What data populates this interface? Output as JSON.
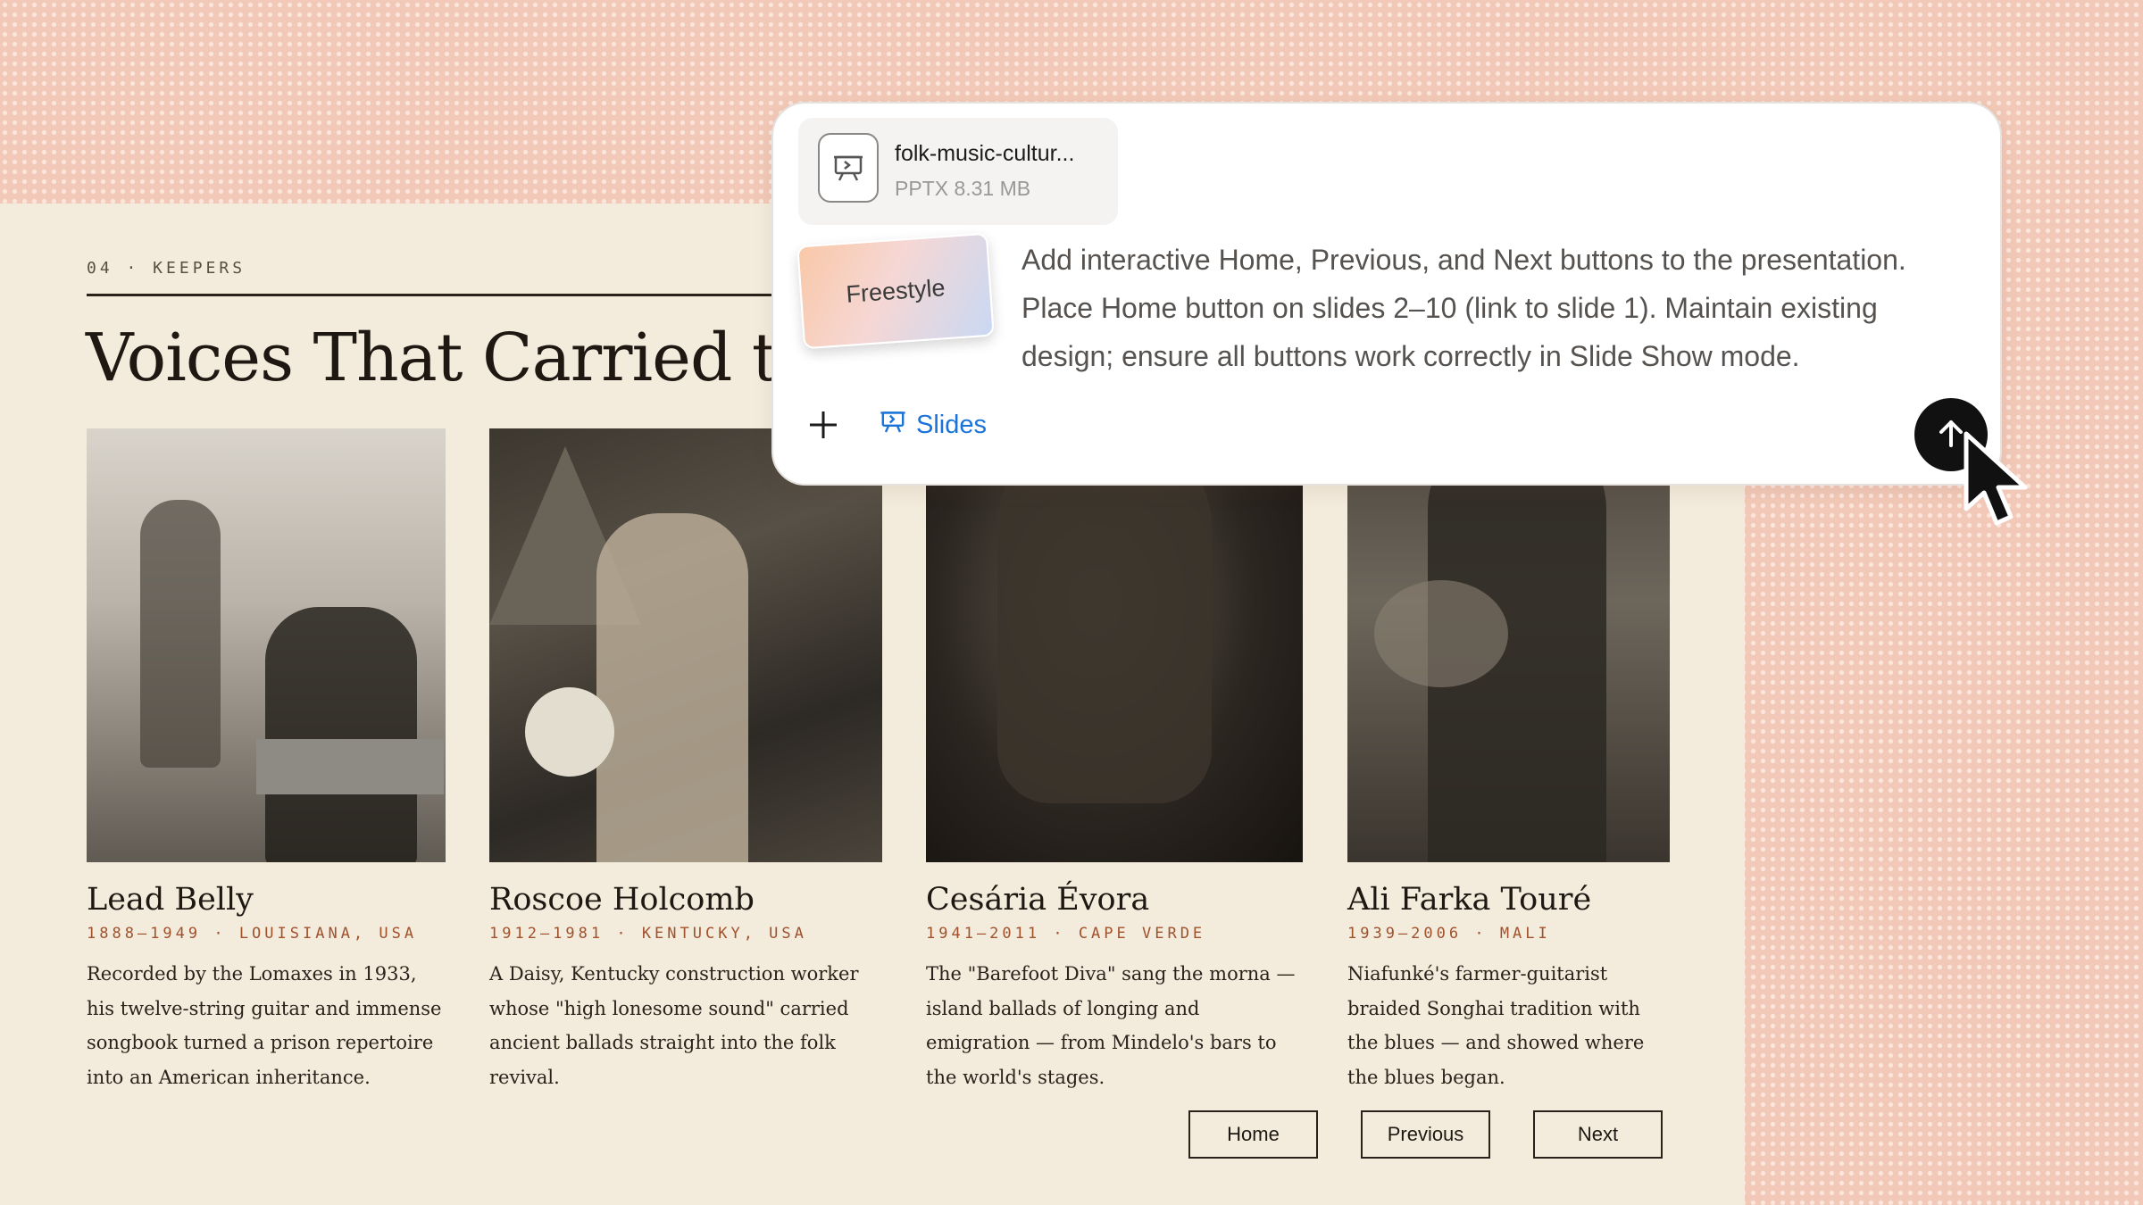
{
  "slide": {
    "eyebrow": "04 · KEEPERS",
    "title": "Voices That Carried the",
    "cards": [
      {
        "name": "Lead Belly",
        "meta": "1888–1949 · LOUISIANA, USA",
        "description": "Recorded by the Lomaxes in 1933, his twelve-string guitar and immense songbook turned a prison repertoire into an American inheritance."
      },
      {
        "name": "Roscoe Holcomb",
        "meta": "1912–1981 · KENTUCKY, USA",
        "description": "A Daisy, Kentucky construction worker whose \"high lonesome sound\" carried ancient ballads straight into the folk revival."
      },
      {
        "name": "Cesária Évora",
        "meta": "1941–2011 · CAPE VERDE",
        "description": "The \"Barefoot Diva\" sang the morna — island ballads of longing and emigration — from Mindelo's bars to the world's stages."
      },
      {
        "name": "Ali Farka Touré",
        "meta": "1939–2006 · MALI",
        "description": "Niafunké's farmer-guitarist braided Songhai tradition with the blues — and showed where the blues began."
      }
    ],
    "nav": {
      "home": "Home",
      "previous": "Previous",
      "next": "Next"
    }
  },
  "composer": {
    "attachment": {
      "file_name": "folk-music-cultur...",
      "file_meta": "PPTX 8.31 MB",
      "icon": "presentation-file-icon"
    },
    "style_chip": "Freestyle",
    "prompt": "Add interactive Home, Previous, and Next buttons to the presentation. Place Home button on slides 2–10 (link to slide 1). Maintain existing design; ensure all buttons work correctly in Slide Show mode.",
    "tool_tag": "Slides",
    "tool_color": "#1a73d8",
    "icons": {
      "add": "plus-icon",
      "tool": "presentation-icon",
      "send": "arrow-up-icon",
      "cursor": "mouse-pointer-icon"
    }
  },
  "colors": {
    "background": "#f2c9b8",
    "slide": "#f3ebdc",
    "accent_meta": "#a0522d",
    "send_button": "#111111"
  }
}
